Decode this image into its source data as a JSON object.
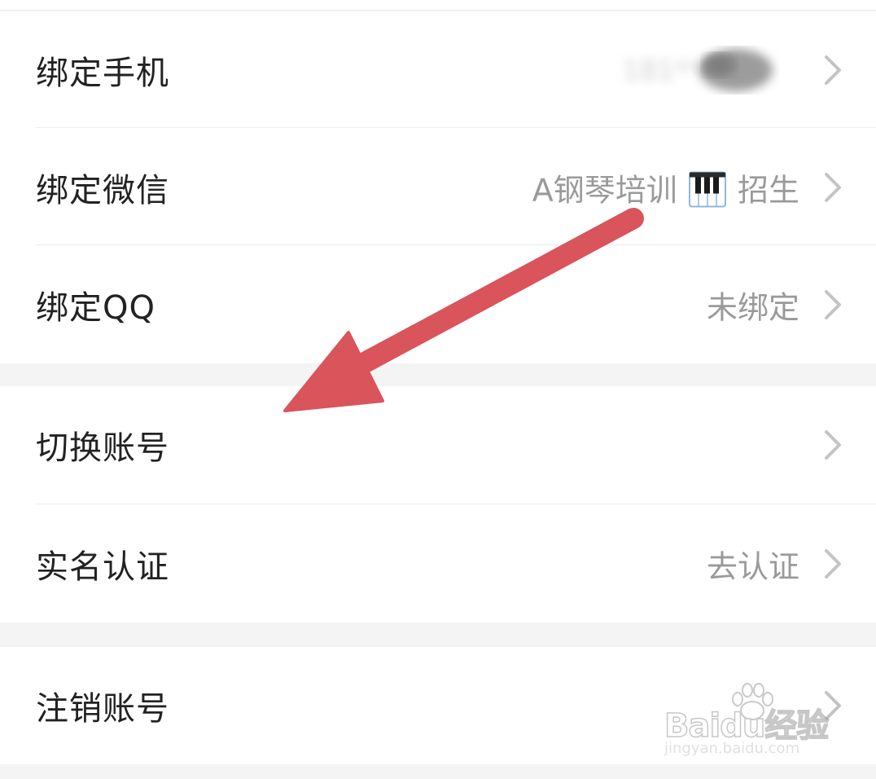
{
  "groups": [
    {
      "rows": [
        {
          "label": "绑定手机",
          "value": "181****0"
        },
        {
          "label": "绑定微信",
          "value_before_icon": "A钢琴培训",
          "value_icon": "piano-icon",
          "value_after_icon": "招生"
        },
        {
          "label": "绑定QQ",
          "value": "未绑定"
        }
      ]
    },
    {
      "rows": [
        {
          "label": "切换账号",
          "value": ""
        },
        {
          "label": "实名认证",
          "value": "去认证"
        }
      ]
    },
    {
      "rows": [
        {
          "label": "注销账号",
          "value": ""
        }
      ]
    }
  ],
  "colors": {
    "background": "#f4f4f4",
    "row_background": "#ffffff",
    "label_text": "#222222",
    "value_text": "#9a9a9a",
    "chevron": "#c4c4c4",
    "annotation_arrow": "#d9545b"
  },
  "icons": {
    "row_chevron": "chevron-right-icon",
    "annotation": "red-arrow-annotation"
  },
  "watermark": {
    "logo_text": "Baidu经验",
    "url_text": "jingyan.baidu.com"
  }
}
